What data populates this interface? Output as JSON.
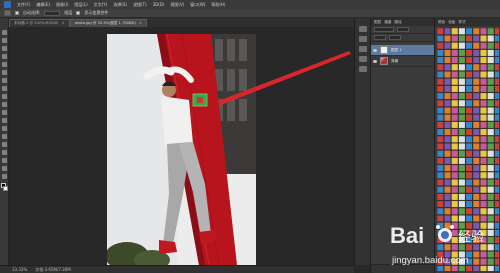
{
  "menubar": {
    "items": [
      "文件(F)",
      "编辑(E)",
      "图像(I)",
      "图层(L)",
      "文字(Y)",
      "选择(S)",
      "滤镜(T)",
      "3D(D)",
      "视图(V)",
      "窗口(W)",
      "帮助(H)"
    ]
  },
  "optbar": {
    "label_1": "自动选择:",
    "label_2": "图层",
    "label_3": "显示变换控件"
  },
  "tabs": [
    {
      "label": "未标题-1 @ 100%(RGB/8)"
    },
    {
      "label": "photo.jpg @ 33.3%(图层 1, RGB/8)"
    }
  ],
  "layers": {
    "panel_tabs": [
      "图层",
      "通道",
      "路径"
    ],
    "rows": [
      {
        "name": "图层 1"
      },
      {
        "name": "背景"
      }
    ]
  },
  "swatches": {
    "panel_tabs": [
      "颜色",
      "色板",
      "样式"
    ],
    "colors": [
      "#c8413b",
      "#d9822b",
      "#e8c840",
      "#5aa04a",
      "#3a84c8",
      "#7a5ab0",
      "#c85a9a",
      "#e0e0e0"
    ]
  },
  "status": {
    "zoom": "33.33%",
    "doc_info": "文档:3.65M/7.30M"
  },
  "watermark": {
    "brand": "Bai",
    "brand_suffix": "经验",
    "url": "jingyan.baidu.com"
  }
}
